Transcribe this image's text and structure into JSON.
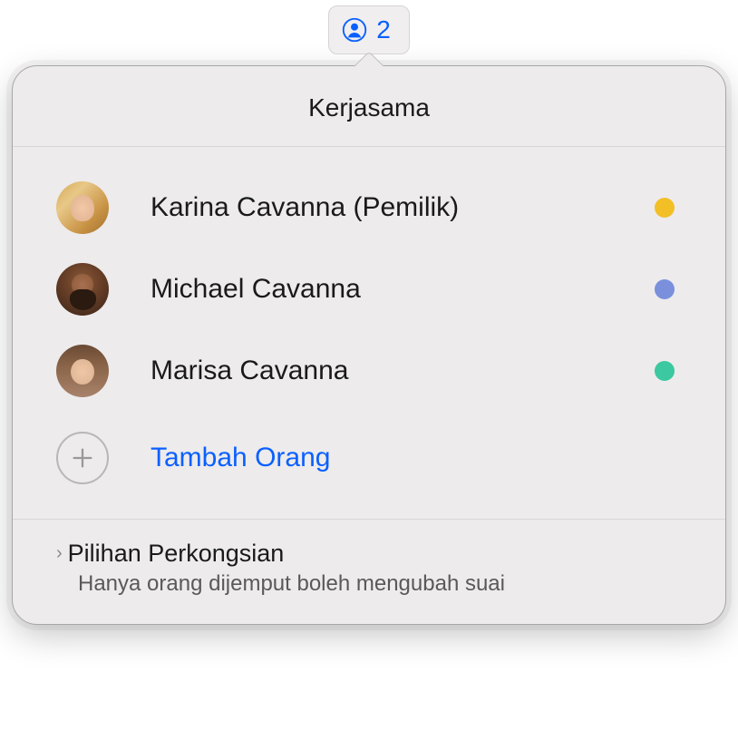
{
  "trigger": {
    "count": "2",
    "icon_color": "#0a60ff"
  },
  "popover": {
    "title": "Kerjasama"
  },
  "participants": [
    {
      "name": "Karina Cavanna (Pemilik)",
      "dot_color": "#f2bf27"
    },
    {
      "name": "Michael Cavanna",
      "dot_color": "#7a90dd"
    },
    {
      "name": "Marisa Cavanna",
      "dot_color": "#3cc8a0"
    }
  ],
  "add_person": {
    "label": "Tambah Orang"
  },
  "sharing": {
    "title": "Pilihan Perkongsian",
    "subtitle": "Hanya orang dijemput boleh mengubah suai"
  }
}
